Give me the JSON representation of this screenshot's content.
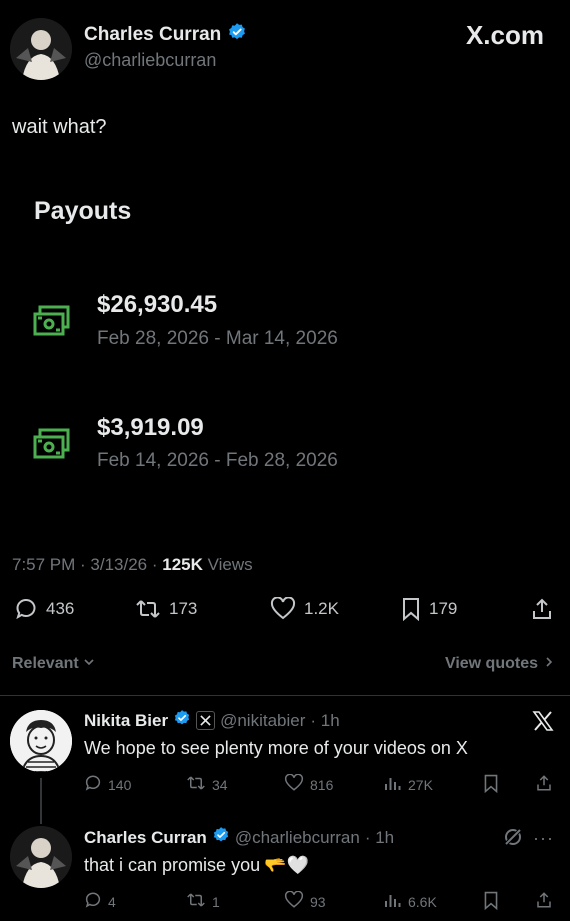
{
  "brand": {
    "site": "X.com"
  },
  "post": {
    "author_name": "Charles Curran",
    "author_handle": "@charliebcurran",
    "text": "wait what?",
    "payouts_title": "Payouts",
    "payouts": [
      {
        "amount": "$26,930.45",
        "range": "Feb 28, 2026 - Mar 14, 2026"
      },
      {
        "amount": "$3,919.09",
        "range": "Feb 14, 2026 - Feb 28, 2026"
      }
    ],
    "meta_time": "7:57 PM · 3/13/26 · ",
    "meta_views_count": "125K",
    "meta_views_label": " Views",
    "stats": {
      "replies": "436",
      "reposts": "173",
      "likes": "1.2K",
      "bookmarks": "179"
    }
  },
  "filters": {
    "sort": "Relevant",
    "view_quotes": "View quotes"
  },
  "replies": [
    {
      "name": "Nikita Bier",
      "handle": "@nikitabier",
      "age": "· 1h",
      "text": "We hope to see plenty more of your videos on X",
      "stats": {
        "replies": "140",
        "reposts": "34",
        "likes": "816",
        "views": "27K"
      }
    },
    {
      "name": "Charles Curran",
      "handle": "@charliebcurran",
      "age": "· 1h",
      "text": "that i can promise you",
      "emojis": "🫳🤍",
      "stats": {
        "replies": "4",
        "reposts": "1",
        "likes": "93",
        "views": "6.6K"
      }
    }
  ],
  "colors": {
    "verified": "#1d9bf0",
    "money": "#4caf50",
    "muted": "#71767b"
  }
}
